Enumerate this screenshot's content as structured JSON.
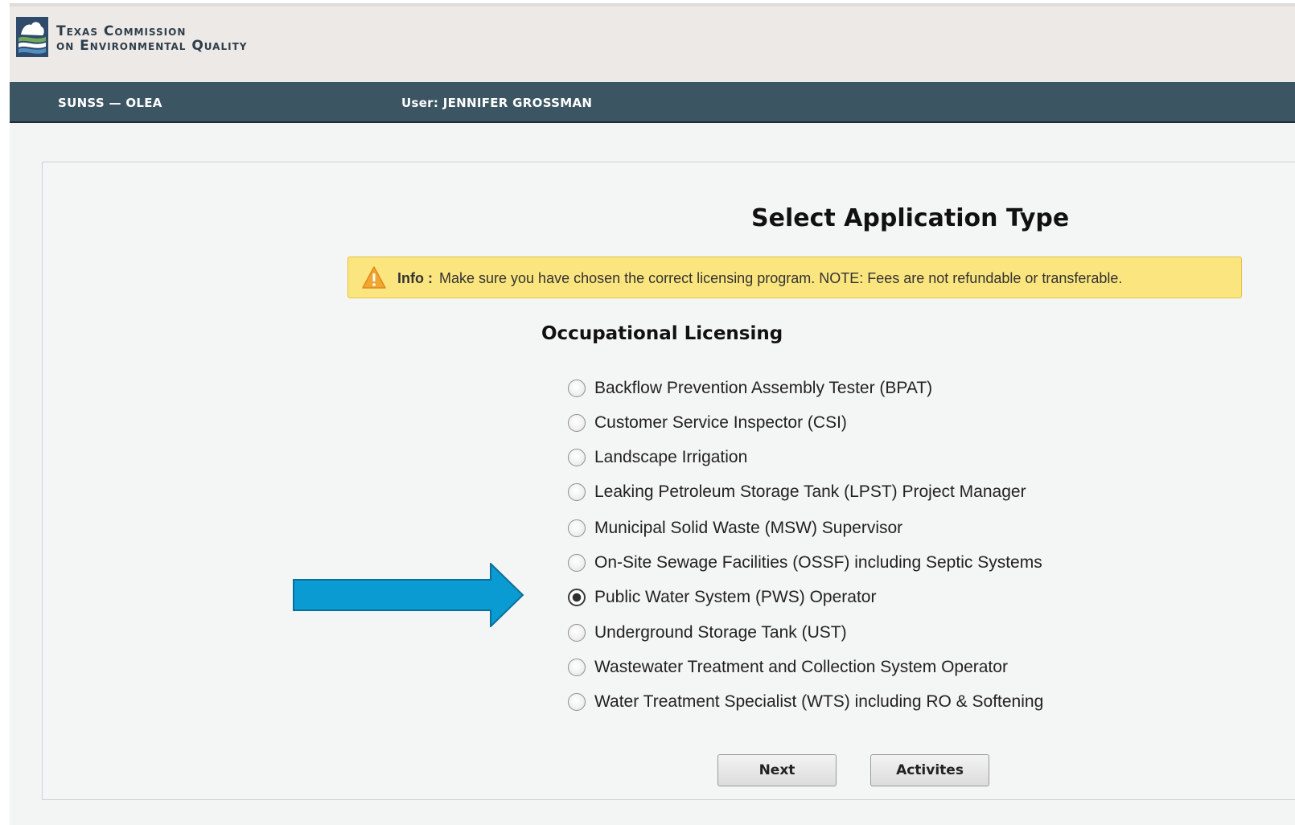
{
  "header": {
    "agency_line1": "Texas Commission",
    "agency_line2": "on Environmental Quality",
    "logo_icon": "tceq-logo-icon"
  },
  "navbar": {
    "app_name": "SUNSS — OLEA",
    "user": "User: JENNIFER GROSSMAN"
  },
  "main": {
    "title": "Select Application Type",
    "info": {
      "icon": "warning-icon",
      "label": "Info :",
      "text": "Make sure you have chosen the correct licensing program. NOTE: Fees are not refundable or transferable."
    },
    "section_title": "Occupational Licensing",
    "options": [
      {
        "label": "Backflow Prevention Assembly Tester (BPAT)",
        "checked": false
      },
      {
        "label": "Customer Service Inspector (CSI)",
        "checked": false
      },
      {
        "label": "Landscape Irrigation",
        "checked": false
      },
      {
        "label": "Leaking Petroleum Storage Tank (LPST) Project Manager",
        "checked": false
      },
      {
        "label": "Municipal Solid Waste (MSW) Supervisor",
        "checked": false
      },
      {
        "label": "On-Site Sewage Facilities (OSSF) including Septic Systems",
        "checked": false
      },
      {
        "label": "Public Water System (PWS) Operator",
        "checked": true
      },
      {
        "label": "Underground Storage Tank (UST)",
        "checked": false
      },
      {
        "label": "Wastewater Treatment and Collection System Operator",
        "checked": false
      },
      {
        "label": "Water Treatment Specialist (WTS) including RO & Softening",
        "checked": false
      }
    ],
    "selected_value": "Public Water System (PWS) Operator",
    "buttons": {
      "next": "Next",
      "activities": "Activites"
    }
  },
  "colors": {
    "navbar": "#3c5563",
    "header": "#ede9e6",
    "info_banner": "#fbe57f",
    "arrow": "#0a9bd3"
  }
}
